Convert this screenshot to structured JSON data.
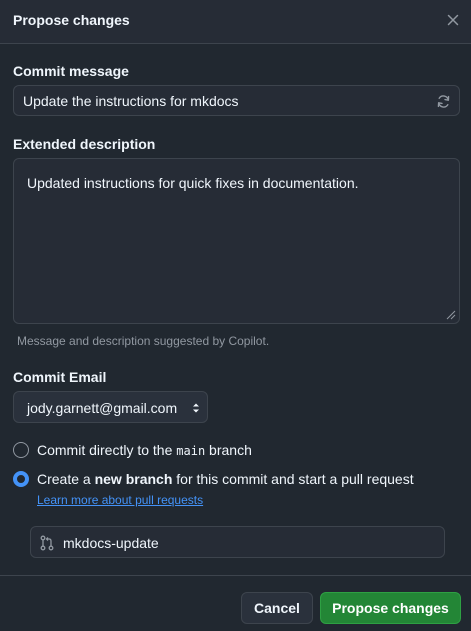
{
  "dialog": {
    "title": "Propose changes",
    "close_icon": "x-icon"
  },
  "commit_message": {
    "label": "Commit message",
    "value": "Update the instructions for mkdocs",
    "regenerate_icon": "sync-icon"
  },
  "extended_description": {
    "label": "Extended description",
    "value": "Updated instructions for quick fixes in documentation.",
    "hint": "Message and description suggested by Copilot."
  },
  "commit_email": {
    "label": "Commit Email",
    "selected": "jody.garnett@gmail.com"
  },
  "options": {
    "direct": {
      "prefix": "Commit directly to the ",
      "branch": "main",
      "suffix": " branch",
      "selected": false
    },
    "new_branch": {
      "prefix": "Create a ",
      "bold": "new branch",
      "suffix": " for this commit and start a pull request",
      "selected": true,
      "learn_more": "Learn more about pull requests"
    }
  },
  "branch_name": {
    "value": "mkdocs-update",
    "icon": "git-pull-request-icon"
  },
  "footer": {
    "cancel_label": "Cancel",
    "submit_label": "Propose changes"
  },
  "colors": {
    "background": "#212830",
    "accent": "#4493f8",
    "primary_button": "#238636"
  }
}
